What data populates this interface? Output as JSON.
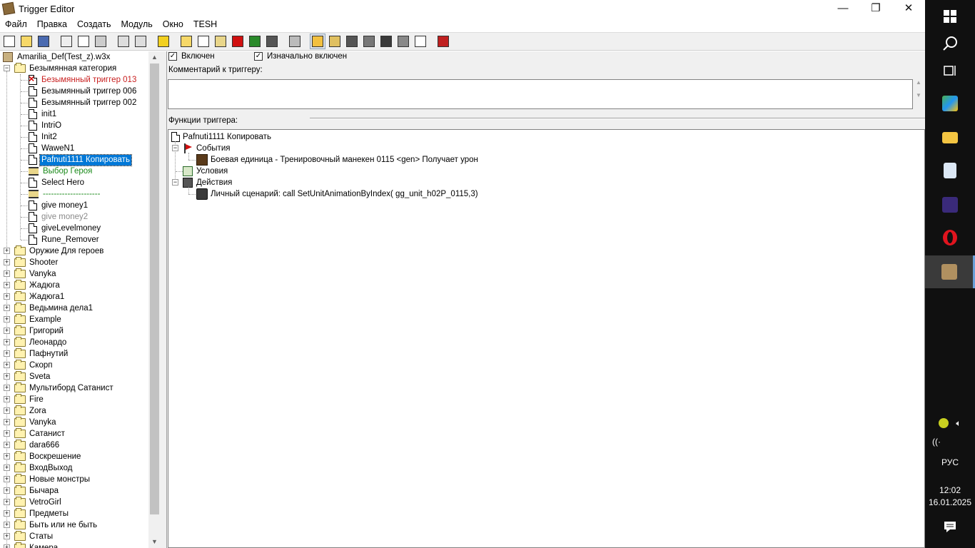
{
  "window": {
    "title": "Trigger Editor",
    "minimize_glyph": "—",
    "restore_glyph": "❐",
    "close_glyph": "✕"
  },
  "menu": [
    "Файл",
    "Правка",
    "Создать",
    "Модуль",
    "Окно",
    "TESH"
  ],
  "toolbar_icons": [
    "new-icon",
    "open-icon",
    "save-icon",
    "cut-icon",
    "copy-icon",
    "paste-icon",
    "undo-icon",
    "redo-icon",
    "delete-icon",
    "new-category-icon",
    "new-trigger-icon",
    "new-comment-icon",
    "new-event-icon",
    "new-condition-icon",
    "new-action-icon",
    "terrain-editor-icon",
    "trigger-editor-icon",
    "sound-editor-icon",
    "object-editor-icon",
    "campaign-editor-icon",
    "ai-editor-icon",
    "object-manager-icon",
    "import-manager-icon",
    "test-map-icon"
  ],
  "tree": {
    "map": "Amarilia_Def(Test_z).w3x",
    "root_category": "Безымянная категория",
    "children": [
      {
        "label": "Безымянный триггер 013",
        "kind": "disabled"
      },
      {
        "label": "Безымянный триггер 006",
        "kind": "trigger"
      },
      {
        "label": "Безымянный триггер 002",
        "kind": "trigger"
      },
      {
        "label": "init1",
        "kind": "trigger"
      },
      {
        "label": "IntriO",
        "kind": "trigger"
      },
      {
        "label": "Init2",
        "kind": "trigger"
      },
      {
        "label": "WaweN1",
        "kind": "trigger"
      },
      {
        "label": "Pafnuti1111 Копировать",
        "kind": "selected"
      },
      {
        "label": "Выбор Героя",
        "kind": "comment"
      },
      {
        "label": "Select Hero",
        "kind": "trigger"
      },
      {
        "label": "---------------------",
        "kind": "comment"
      },
      {
        "label": "give money1",
        "kind": "trigger"
      },
      {
        "label": "give money2",
        "kind": "grey"
      },
      {
        "label": "giveLevelmoney",
        "kind": "trigger"
      },
      {
        "label": "Rune_Remover",
        "kind": "trigger"
      }
    ],
    "categories": [
      "Оружие Для героев",
      "Shooter",
      "Vanyka",
      "Жадюга",
      "Жадюга1",
      "Ведьмина дела1",
      "Example",
      "Григорий",
      "Леонардо",
      "Пафнутий",
      "Скорп",
      "Sveta",
      "Мультиборд Сатанист",
      "Fire",
      "Zora",
      "Vanyka",
      "Сатанист",
      "dara666",
      "Воскрешение",
      "ВходВыход",
      "Новые монстры",
      "Бычара",
      "VetroGirl",
      "Предметы",
      "Быть или не быть",
      "Статы",
      "Камера"
    ]
  },
  "colors": {
    "disabled": "#c81e1e",
    "comment": "#1a8a1a",
    "grey": "#8a8a8a",
    "selection": "#0078d7"
  },
  "panel": {
    "enabled_label": "Включен",
    "initially_on_label": "Изначально включен",
    "check_glyph": "✓",
    "comment_label": "Комментарий к триггеру:",
    "functions_label": "Функции триггера:",
    "trigger_name": "Pafnuti1111 Копировать",
    "events_label": "События",
    "event_1": "Боевая единица - Тренировочный манекен 0115 <gen> Получает урон",
    "conditions_label": "Условия",
    "actions_label": "Действия",
    "action_1": "Личный сценарий:   call SetUnitAnimationByIndex( gg_unit_h02P_0115,3)"
  },
  "taskbar": {
    "language": "РУС",
    "time": "12:02",
    "date": "16.01.2025"
  }
}
